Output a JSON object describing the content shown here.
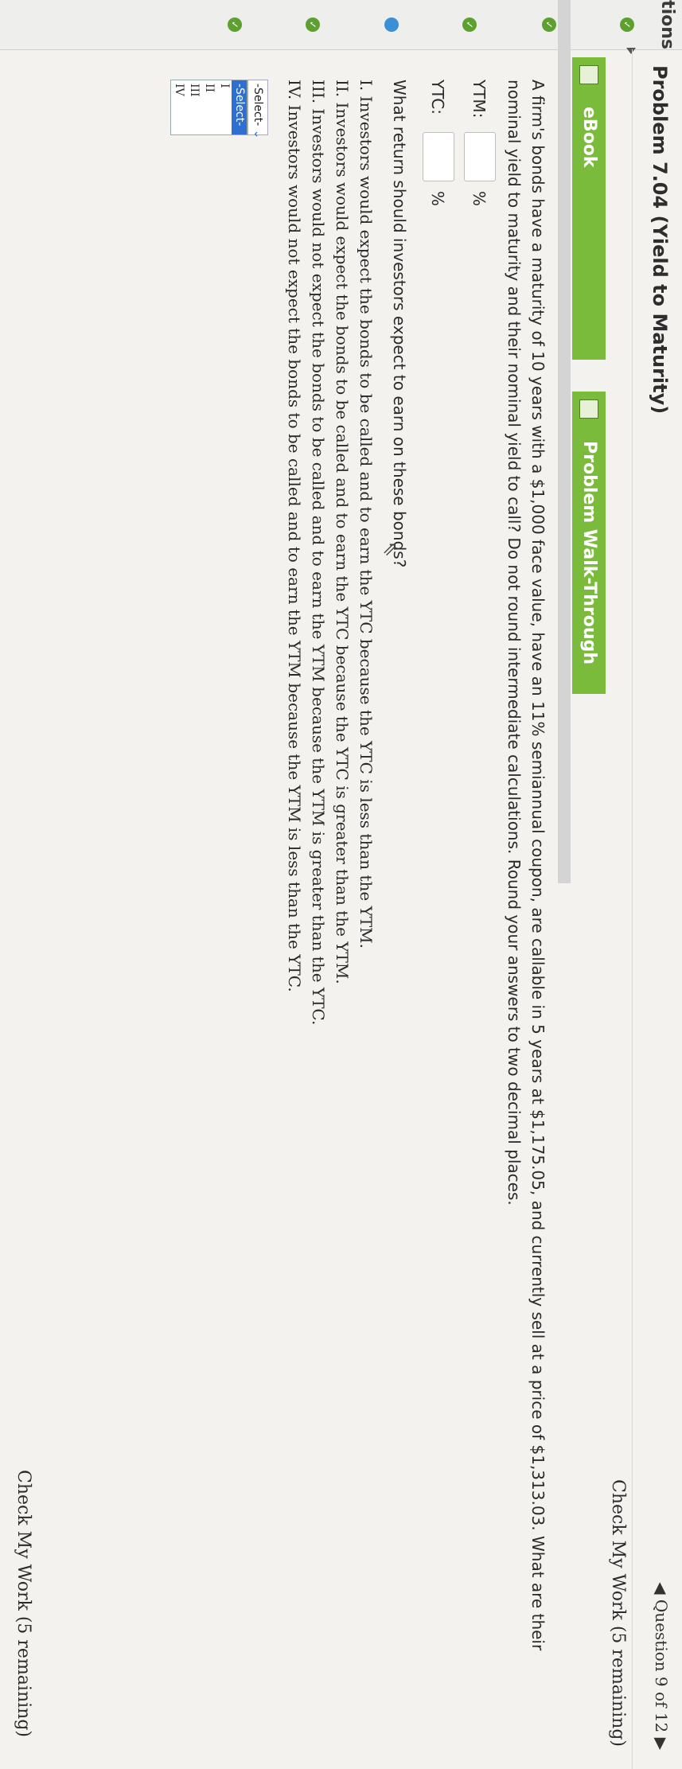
{
  "sidebar": {
    "title": "tions",
    "items": [
      {
        "status": "complete"
      },
      {
        "status": "complete"
      },
      {
        "status": "complete"
      },
      {
        "status": "current"
      },
      {
        "status": "complete"
      },
      {
        "status": "complete"
      }
    ]
  },
  "header": {
    "title": "Problem 7.04 (Yield to Maturity)",
    "question_nav": "◀ Question 9 of 12 ▶"
  },
  "check_my_work_label": "Check My Work (5 remaining)",
  "tabs": {
    "ebook": "eBook",
    "walkthrough": "Problem Walk-Through"
  },
  "question": {
    "prompt_line1": "A firm's bonds have a maturity of 10 years with a $1,000 face value, have an 11% semiannual coupon, are callable in 5 years at $1,175.05, and currently sell at a price of $1,313.03. What are their",
    "prompt_line2": "nominal yield to maturity and their nominal yield to call? Do not round intermediate calculations. Round your answers to two decimal places.",
    "ytm_label": "YTM:",
    "ytc_label": "YTC:",
    "percent_symbol": "%",
    "followup": "What return should investors expect to earn on these bonds?",
    "options": [
      "I. Investors would expect the bonds to be called and to earn the YTC because the YTC is less than the YTM.",
      "II. Investors would expect the bonds to be called and to earn the YTC because the YTC is greater than the YTM.",
      "III. Investors would not expect the bonds to be called and to earn the YTM because the YTM is greater than the YTC.",
      "IV. Investors would not expect the bonds to be called and to earn the YTM because the YTM is less than the YTC."
    ],
    "select": {
      "current": "-Select-",
      "options": [
        "-Select-",
        "I",
        "II",
        "III",
        "IV"
      ]
    }
  },
  "colors": {
    "tab_green": "#7bbb3c",
    "check_green": "#5ea02f",
    "current_blue": "#3a8fd6",
    "selected_blue": "#2f6fd1"
  }
}
